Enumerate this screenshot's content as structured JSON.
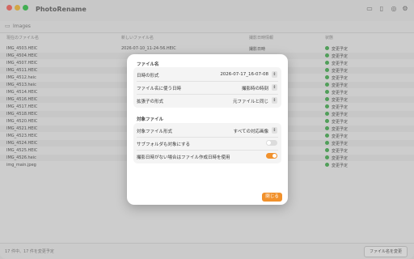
{
  "app": {
    "title": "PhotoRename"
  },
  "colors": {
    "accent": "#f1912c",
    "status_ok": "#3db04a",
    "traffic_red": "#ff5f57",
    "traffic_yellow": "#febc2e",
    "traffic_green": "#28c840"
  },
  "toolbar": {
    "icons": [
      "folder-icon",
      "document-icon",
      "search-icon",
      "gear-icon"
    ]
  },
  "path": {
    "label": "Images"
  },
  "table": {
    "headers": [
      "現在のファイル名",
      "新しいファイル名",
      "撮影日時情報",
      "状態"
    ],
    "rows": [
      {
        "current": "IMG_4503.HEIC",
        "new": "2026-07-10_11-24-56.HEIC",
        "exif": "撮影日時",
        "status": "変更予定"
      },
      {
        "current": "IMG_4504.HEIC",
        "new": "",
        "exif": "",
        "status": "変更予定"
      },
      {
        "current": "IMG_4507.HEIC",
        "new": "",
        "exif": "",
        "status": "変更予定"
      },
      {
        "current": "IMG_4511.HEIC",
        "new": "",
        "exif": "",
        "status": "変更予定"
      },
      {
        "current": "IMG_4512.heic",
        "new": "",
        "exif": "",
        "status": "変更予定"
      },
      {
        "current": "IMG_4513.heic",
        "new": "",
        "exif": "",
        "status": "変更予定"
      },
      {
        "current": "IMG_4514.HEIC",
        "new": "",
        "exif": "",
        "status": "変更予定"
      },
      {
        "current": "IMG_4516.HEIC",
        "new": "",
        "exif": "",
        "status": "変更予定"
      },
      {
        "current": "IMG_4517.HEIC",
        "new": "",
        "exif": "",
        "status": "変更予定"
      },
      {
        "current": "IMG_4518.HEIC",
        "new": "",
        "exif": "",
        "status": "変更予定"
      },
      {
        "current": "IMG_4520.HEIC",
        "new": "",
        "exif": "",
        "status": "変更予定"
      },
      {
        "current": "IMG_4521.HEIC",
        "new": "",
        "exif": "",
        "status": "変更予定"
      },
      {
        "current": "IMG_4523.HEIC",
        "new": "",
        "exif": "",
        "status": "変更予定"
      },
      {
        "current": "IMG_4524.HEIC",
        "new": "",
        "exif": "",
        "status": "変更予定"
      },
      {
        "current": "IMG_4525.HEIC",
        "new": "",
        "exif": "",
        "status": "変更予定"
      },
      {
        "current": "IMG_4526.heic",
        "new": "",
        "exif": "",
        "status": "変更予定"
      },
      {
        "current": "img_main.jpeg",
        "new": "",
        "exif": "",
        "status": "変更予定"
      }
    ]
  },
  "statusbar": {
    "text": "17 件中、17 件を変更予定",
    "rename_button": "ファイル名を変更"
  },
  "dialog": {
    "section1_title": "ファイル名",
    "date_format_label": "日時の形式",
    "date_format_value": "2026-07-17_16-07-08",
    "date_source_label": "ファイル名に使う日時",
    "date_source_value": "撮影時の時刻",
    "ext_format_label": "拡張子の形式",
    "ext_format_value": "元ファイルと同じ",
    "section2_title": "対象ファイル",
    "target_format_label": "対象ファイル形式",
    "target_format_value": "すべての対応画像",
    "subfolder_label": "サブフォルダも対象にする",
    "subfolder_on": false,
    "fallback_label": "撮影日時がない場合はファイル作成日時を使用",
    "fallback_on": true,
    "close_button": "閉じる"
  }
}
